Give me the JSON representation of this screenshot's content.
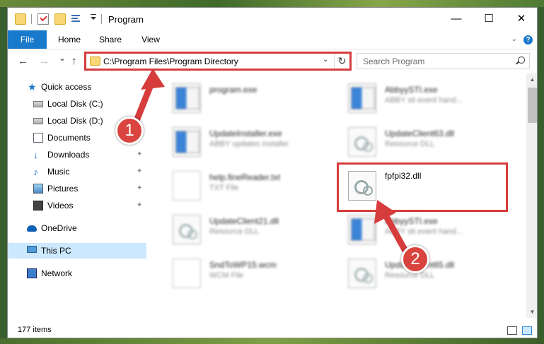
{
  "window": {
    "title": "Program",
    "controls": {
      "minimize": "—",
      "maximize": "☐",
      "close": "✕"
    }
  },
  "ribbon": {
    "tabs": [
      "File",
      "Home",
      "Share",
      "View"
    ],
    "help": "?"
  },
  "navbar": {
    "back": "←",
    "forward": "→",
    "recent": "⌄",
    "up": "↑",
    "address": "C:\\Program Files\\Program Directory",
    "search_placeholder": "Search Program"
  },
  "sidebar": {
    "items": [
      {
        "label": "Quick access",
        "icon": "star-icon",
        "pinned": false
      },
      {
        "label": "Local Disk (C:)",
        "icon": "disk-icon",
        "pinned": false
      },
      {
        "label": "Local Disk (D:)",
        "icon": "disk-icon",
        "pinned": false
      },
      {
        "label": "Documents",
        "icon": "documents-icon",
        "pinned": true
      },
      {
        "label": "Downloads",
        "icon": "download-icon",
        "pinned": true
      },
      {
        "label": "Music",
        "icon": "music-icon",
        "pinned": true
      },
      {
        "label": "Pictures",
        "icon": "pictures-icon",
        "pinned": true
      },
      {
        "label": "Videos",
        "icon": "videos-icon",
        "pinned": true
      },
      {
        "label": "OneDrive",
        "icon": "cloud-icon",
        "pinned": false
      },
      {
        "label": "This PC",
        "icon": "computer-icon",
        "pinned": false,
        "selected": true
      },
      {
        "label": "Network",
        "icon": "network-icon",
        "pinned": false
      }
    ],
    "pin_glyph": "📌"
  },
  "files": [
    {
      "name": "program.exe",
      "sub": "",
      "type": "exe",
      "blurred": true
    },
    {
      "name": "AbbyySTI.exe",
      "sub": "ABBY sti event hand...",
      "type": "exe",
      "blurred": true
    },
    {
      "name": "UpdateInstaller.exe",
      "sub": "ABBY updates installer",
      "type": "exe",
      "blurred": true
    },
    {
      "name": "UpdateClient63.dll",
      "sub": "Resource DLL",
      "type": "dll",
      "blurred": true
    },
    {
      "name": "help.fineReader.txt",
      "sub": "TXT File",
      "type": "txt",
      "blurred": true
    },
    {
      "name": "fpfpi32.dll",
      "sub": "",
      "type": "dll",
      "blurred": false
    },
    {
      "name": "UpdateClient21.dll",
      "sub": "Resource DLL",
      "type": "dll",
      "blurred": true
    },
    {
      "name": "AbbyySTI.exe",
      "sub": "ABBY sti event hand...",
      "type": "exe",
      "blurred": true
    },
    {
      "name": "SndToWP15.wcm",
      "sub": "WCM File",
      "type": "txt",
      "blurred": true
    },
    {
      "name": "UpdateClient65.dll",
      "sub": "Resource DLL",
      "type": "dll",
      "blurred": true
    }
  ],
  "status": {
    "item_count": "177 items"
  },
  "annotations": {
    "step1": "1",
    "step2": "2",
    "color": "#d63c3c"
  }
}
